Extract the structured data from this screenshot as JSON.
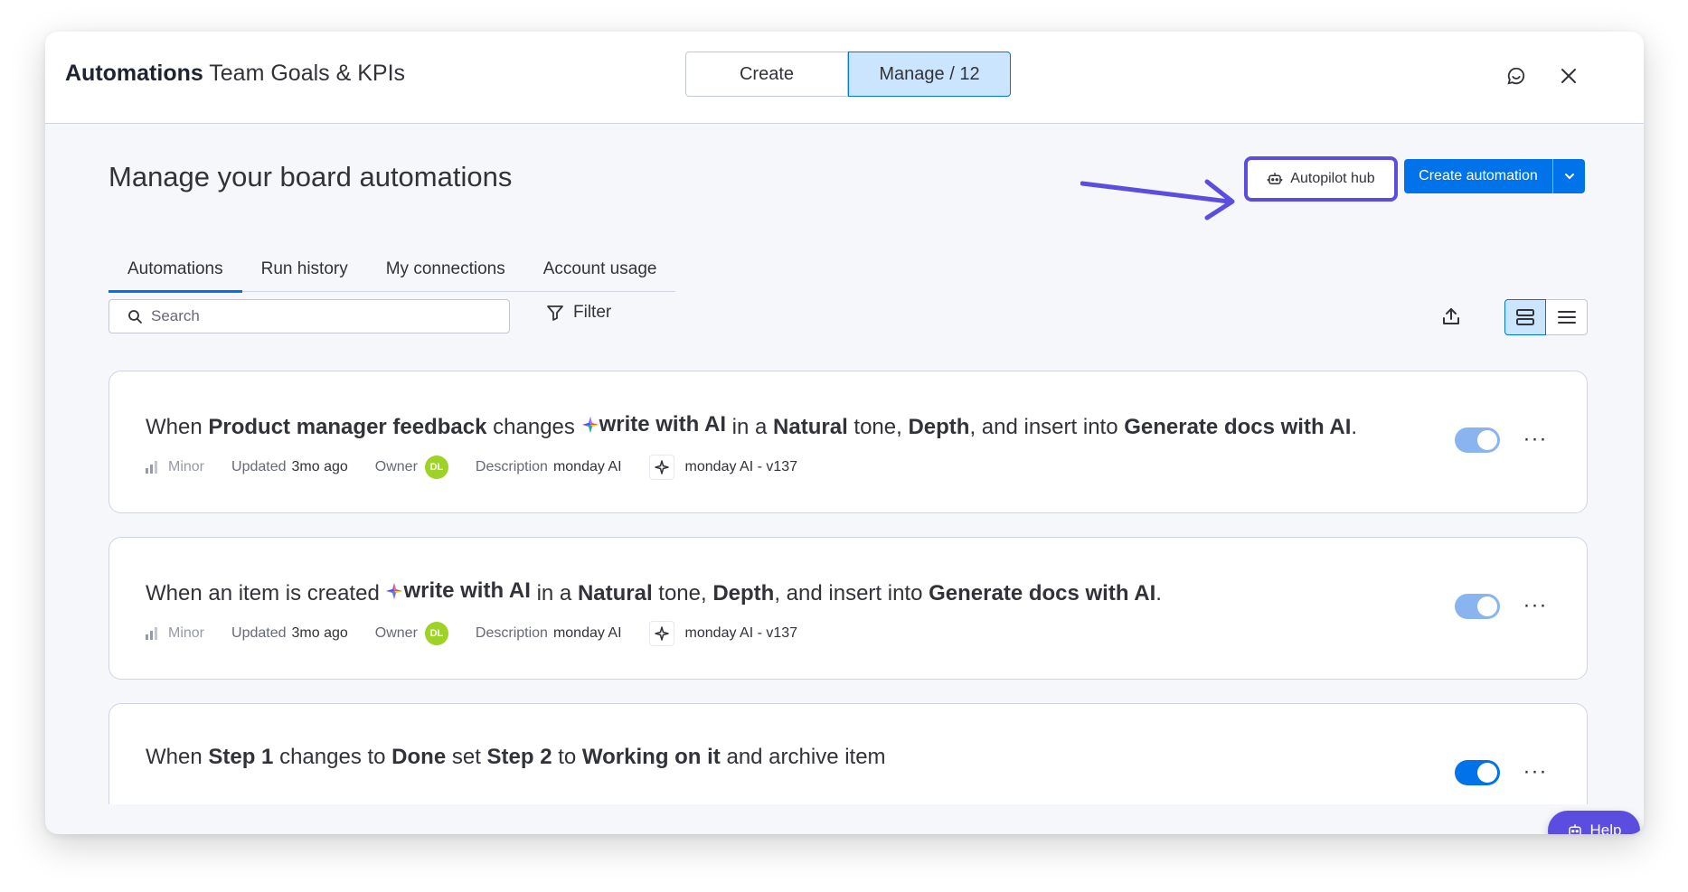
{
  "header": {
    "app_title": "Automations",
    "board_name": "Team Goals & KPIs",
    "tabs": [
      {
        "label": "Create"
      },
      {
        "label": "Manage / 12"
      }
    ]
  },
  "page": {
    "title": "Manage your board automations",
    "autopilot_label": "Autopilot hub",
    "create_label": "Create automation",
    "search_placeholder": "Search",
    "filter_label": "Filter",
    "help_label": "Help"
  },
  "subtabs": [
    {
      "label": "Automations"
    },
    {
      "label": "Run history"
    },
    {
      "label": "My connections"
    },
    {
      "label": "Account usage"
    }
  ],
  "automations": [
    {
      "s1": "When ",
      "b1": "Product manager feedback",
      "s2": " changes ",
      "ai": "write with AI",
      "s3": " in a ",
      "b2": "Natural",
      "s4": " tone, ",
      "b3": "Depth",
      "s5": ", and insert into ",
      "b4": "Generate docs with AI",
      "s6": ".",
      "impact": "Minor",
      "updated_label": "Updated",
      "updated_value": "3mo ago",
      "owner_label": "Owner",
      "owner_initials": "DL",
      "desc_label": "Description",
      "desc_value": "monday AI",
      "version": "monday AI - v137",
      "more": "···",
      "enabled": true
    },
    {
      "s1": "When an item is created ",
      "ai": "write with AI",
      "s3": " in a ",
      "b2": "Natural",
      "s4": " tone, ",
      "b3": "Depth",
      "s5": ", and insert into ",
      "b4": "Generate docs with AI",
      "s6": ".",
      "impact": "Minor",
      "updated_label": "Updated",
      "updated_value": "3mo ago",
      "owner_label": "Owner",
      "owner_initials": "DL",
      "desc_label": "Description",
      "desc_value": "monday AI",
      "version": "monday AI - v137",
      "more": "···",
      "enabled": true
    },
    {
      "s1": "When ",
      "b1": "Step 1",
      "s2": " changes to ",
      "b2": "Done",
      "s3": " set ",
      "b3": "Step 2",
      "s4": " to ",
      "b4": "Working on it",
      "s5": " and archive item",
      "more": "···",
      "enabled": true
    }
  ],
  "colors": {
    "accent": "#0073ea",
    "highlight": "#5b4de0",
    "selected_bg": "#cce5ff",
    "owner_avatar": "#9cd326"
  }
}
